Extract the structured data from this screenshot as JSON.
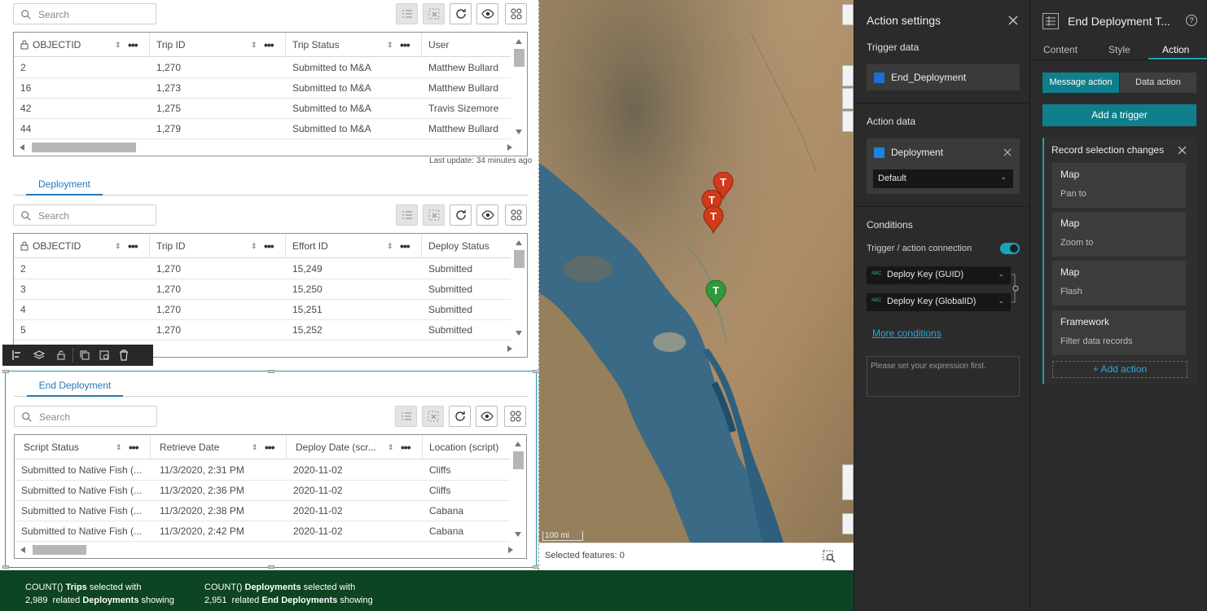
{
  "tables": [
    {
      "search_placeholder": "Search",
      "columns": [
        "OBJECTID",
        "Trip ID",
        "Trip Status",
        "User"
      ],
      "rows": [
        [
          "2",
          "1,270",
          "Submitted to M&A",
          "Matthew Bullard"
        ],
        [
          "16",
          "1,273",
          "Submitted to M&A",
          "Matthew Bullard"
        ],
        [
          "42",
          "1,275",
          "Submitted to M&A",
          "Travis Sizemore"
        ],
        [
          "44",
          "1,279",
          "Submitted to M&A",
          "Matthew Bullard"
        ]
      ],
      "last_update": "Last update: 34 minutes ago"
    },
    {
      "tab_label": "Deployment",
      "search_placeholder": "Search",
      "columns": [
        "OBJECTID",
        "Trip ID",
        "Effort ID",
        "Deploy Status"
      ],
      "rows": [
        [
          "2",
          "1,270",
          "15,249",
          "Submitted"
        ],
        [
          "3",
          "1,270",
          "15,250",
          "Submitted"
        ],
        [
          "4",
          "1,270",
          "15,251",
          "Submitted"
        ],
        [
          "5",
          "1,270",
          "15,252",
          "Submitted"
        ]
      ]
    },
    {
      "tab_label": "End Deployment",
      "search_placeholder": "Search",
      "columns": [
        "Script Status",
        "Retrieve Date",
        "Deploy Date (scr...",
        "Location (script)"
      ],
      "rows": [
        [
          "Submitted to Native Fish (...",
          "11/3/2020, 2:31 PM",
          "2020-11-02",
          "Cliffs"
        ],
        [
          "Submitted to Native Fish (...",
          "11/3/2020, 2:36 PM",
          "2020-11-02",
          "Cliffs"
        ],
        [
          "Submitted to Native Fish (...",
          "11/3/2020, 2:38 PM",
          "2020-11-02",
          "Cabana"
        ],
        [
          "Submitted to Native Fish (...",
          "11/3/2020, 2:42 PM",
          "2020-11-02",
          "Cabana"
        ]
      ]
    }
  ],
  "map": {
    "scale_label": "100 mi",
    "selected_features": "Selected features: 0",
    "pin_labels": [
      "T",
      "T",
      "T",
      "T"
    ]
  },
  "footer": {
    "block1_line1_prefix": "COUNT()",
    "block1_line1_bold": "Trips",
    "block1_line1_suffix": "selected with",
    "block1_line2_count": "2,989",
    "block1_line2_mid": "related",
    "block1_line2_bold": "Deployments",
    "block1_line2_suffix": "showing",
    "block2_line1_prefix": "COUNT()",
    "block2_line1_bold": "Deployments",
    "block2_line1_suffix": "selected with",
    "block2_line2_count": "2,951",
    "block2_line2_mid": "related",
    "block2_line2_bold": "End Deployments",
    "block2_line2_suffix": "showing"
  },
  "action_settings": {
    "title": "Action settings",
    "trigger_data_label": "Trigger data",
    "trigger_source": "End_Deployment",
    "action_data_label": "Action data",
    "action_source": "Deployment",
    "view_select": "Default",
    "conditions_label": "Conditions",
    "connection_label": "Trigger / action connection",
    "field1": "Deploy Key (GUID)",
    "field2": "Deploy Key (GlobalID)",
    "more_conditions": "More conditions",
    "expression_placeholder": "Please set your expression first."
  },
  "right_panel": {
    "widget_title": "End Deployment T...",
    "tabs": [
      "Content",
      "Style",
      "Action"
    ],
    "active_tab": "Action",
    "message_action": "Message action",
    "data_action": "Data action",
    "add_trigger": "Add a trigger",
    "trigger_name": "Record selection changes",
    "actions": [
      {
        "widget": "Map",
        "action": "Pan to"
      },
      {
        "widget": "Map",
        "action": "Zoom to"
      },
      {
        "widget": "Map",
        "action": "Flash"
      },
      {
        "widget": "Framework",
        "action": "Filter data records"
      }
    ],
    "add_action": "+ Add action"
  },
  "colors": {
    "accent": "#0e7f8b",
    "tab_blue": "#2679b7",
    "footer_green": "#0d4421",
    "pin_red": "#d23a1c",
    "pin_green": "#2f9a3c"
  }
}
